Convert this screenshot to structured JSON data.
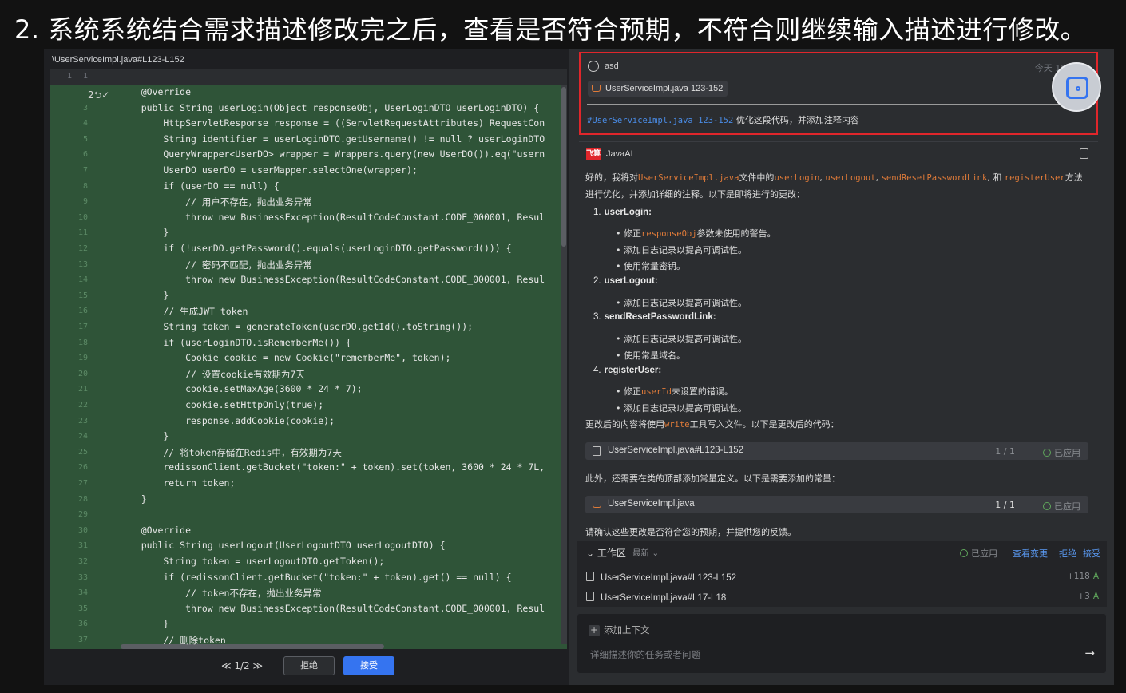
{
  "heading": "2. 系统系统结合需求描述修改完之后，查看是否符合预期，不符合则继续输入描述进行修改。",
  "diff_view": {
    "file_path": "\\UserServiceImpl.java#L123-L152",
    "first_row": {
      "left_ln": "1",
      "right_ln": "1"
    },
    "revert_label": "2⮌✓",
    "lines": [
      {
        "ln": "3",
        "code": "    @Override"
      },
      {
        "ln": "3",
        "code": "    public String userLogin(Object responseObj, UserLoginDTO userLoginDTO) {"
      },
      {
        "ln": "4",
        "code": "        HttpServletResponse response = ((ServletRequestAttributes) RequestCon"
      },
      {
        "ln": "5",
        "code": "        String identifier = userLoginDTO.getUsername() != null ? userLoginDTO"
      },
      {
        "ln": "6",
        "code": "        QueryWrapper<UserDO> wrapper = Wrappers.query(new UserDO()).eq(\"usern"
      },
      {
        "ln": "7",
        "code": "        UserDO userDO = userMapper.selectOne(wrapper);"
      },
      {
        "ln": "8",
        "code": "        if (userDO == null) {"
      },
      {
        "ln": "9",
        "code": "            // 用户不存在，抛出业务异常"
      },
      {
        "ln": "10",
        "code": "            throw new BusinessException(ResultCodeConstant.CODE_000001, Resul"
      },
      {
        "ln": "11",
        "code": "        }"
      },
      {
        "ln": "12",
        "code": "        if (!userDO.getPassword().equals(userLoginDTO.getPassword())) {"
      },
      {
        "ln": "13",
        "code": "            // 密码不匹配，抛出业务异常"
      },
      {
        "ln": "14",
        "code": "            throw new BusinessException(ResultCodeConstant.CODE_000001, Resul"
      },
      {
        "ln": "15",
        "code": "        }"
      },
      {
        "ln": "16",
        "code": "        // 生成JWT token"
      },
      {
        "ln": "17",
        "code": "        String token = generateToken(userDO.getId().toString());"
      },
      {
        "ln": "18",
        "code": "        if (userLoginDTO.isRememberMe()) {"
      },
      {
        "ln": "19",
        "code": "            Cookie cookie = new Cookie(\"rememberMe\", token);"
      },
      {
        "ln": "20",
        "code": "            // 设置cookie有效期为7天"
      },
      {
        "ln": "21",
        "code": "            cookie.setMaxAge(3600 * 24 * 7);"
      },
      {
        "ln": "22",
        "code": "            cookie.setHttpOnly(true);"
      },
      {
        "ln": "23",
        "code": "            response.addCookie(cookie);"
      },
      {
        "ln": "24",
        "code": "        }"
      },
      {
        "ln": "25",
        "code": "        // 将token存储在Redis中，有效期为7天"
      },
      {
        "ln": "26",
        "code": "        redissonClient.getBucket(\"token:\" + token).set(token, 3600 * 24 * 7L,"
      },
      {
        "ln": "27",
        "code": "        return token;"
      },
      {
        "ln": "28",
        "code": "    }"
      },
      {
        "ln": "29",
        "code": ""
      },
      {
        "ln": "30",
        "code": "    @Override"
      },
      {
        "ln": "31",
        "code": "    public String userLogout(UserLogoutDTO userLogoutDTO) {"
      },
      {
        "ln": "32",
        "code": "        String token = userLogoutDTO.getToken();"
      },
      {
        "ln": "33",
        "code": "        if (redissonClient.getBucket(\"token:\" + token).get() == null) {"
      },
      {
        "ln": "34",
        "code": "            // token不存在，抛出业务异常"
      },
      {
        "ln": "35",
        "code": "            throw new BusinessException(ResultCodeConstant.CODE_000001, Resul"
      },
      {
        "ln": "36",
        "code": "        }"
      },
      {
        "ln": "37",
        "code": "        // 删除token"
      }
    ],
    "pager": "≪ 1/2 ≫",
    "reject_label": "拒绝",
    "accept_label": "接受"
  },
  "chat": {
    "user": {
      "name": "asd",
      "time": "今天 15:31",
      "chip_label": "UserServiceImpl.java 123-152",
      "message_ref": "#UserServiceImpl.java 123-152",
      "message_text": " 优化这段代码，并添加注释内容"
    },
    "ai": {
      "name": "JavaAI",
      "logo_text": "飞算",
      "intro": {
        "p1": "好的，我将对",
        "c1": "UserServiceImpl.java",
        "p2": "文件中的",
        "c2": "userLogin",
        "p3": ", ",
        "c3": "userLogout",
        "p4": ", ",
        "c4": "sendResetPasswordLink",
        "p5": ", 和 ",
        "c5": "registerUser",
        "p6": "方法"
      },
      "intro_line2": "进行优化，并添加详细的注释。以下是即将进行的更改：",
      "items": [
        {
          "n": "1.",
          "title": "userLogin:"
        },
        {
          "n": "2.",
          "title": "userLogout:"
        },
        {
          "n": "3.",
          "title": "sendResetPasswordLink:"
        },
        {
          "n": "4.",
          "title": "registerUser:"
        }
      ],
      "b1_pre": "• 修正",
      "b1_code": "responseObj",
      "b1_post": "参数未使用的警告。",
      "b_log": "• 添加日志记录以提高可调试性。",
      "b_const_key": "• 使用常量密钥。",
      "b_const_domain": "• 使用常量域名。",
      "b4_pre": "• 修正",
      "b4_code": "userId",
      "b4_post": "未设置的错误。",
      "write_pre": "更改后的内容将使用",
      "write_code": "write",
      "write_post": "工具写入文件。以下是更改后的代码：",
      "file1": {
        "name": "UserServiceImpl.java#L123-L152",
        "count": "1 / 1",
        "status": "已应用"
      },
      "extra_text": "此外，还需要在类的顶部添加常量定义。以下是需要添加的常量：",
      "file2": {
        "name": "UserServiceImpl.java",
        "count": "1 / 1",
        "status": "已应用"
      },
      "confirm_text": "请确认这些更改是否符合您的预期，并提供您的反馈。"
    },
    "workspace": {
      "title": "⌄ 工作区",
      "sort": "最新 ⌄",
      "applied": "已应用",
      "view_changes": "查看变更",
      "reject": "拒绝",
      "accept": "接受",
      "files": [
        {
          "name": "UserServiceImpl.java#L123-L152",
          "diff": "+118",
          "tag": "A"
        },
        {
          "name": "UserServiceImpl.java#L17-L18",
          "diff": "+3",
          "tag": "A"
        }
      ]
    },
    "input": {
      "add_context": "添加上下文",
      "placeholder": "详细描述你的任务或者问题",
      "send_icon": "→"
    }
  }
}
